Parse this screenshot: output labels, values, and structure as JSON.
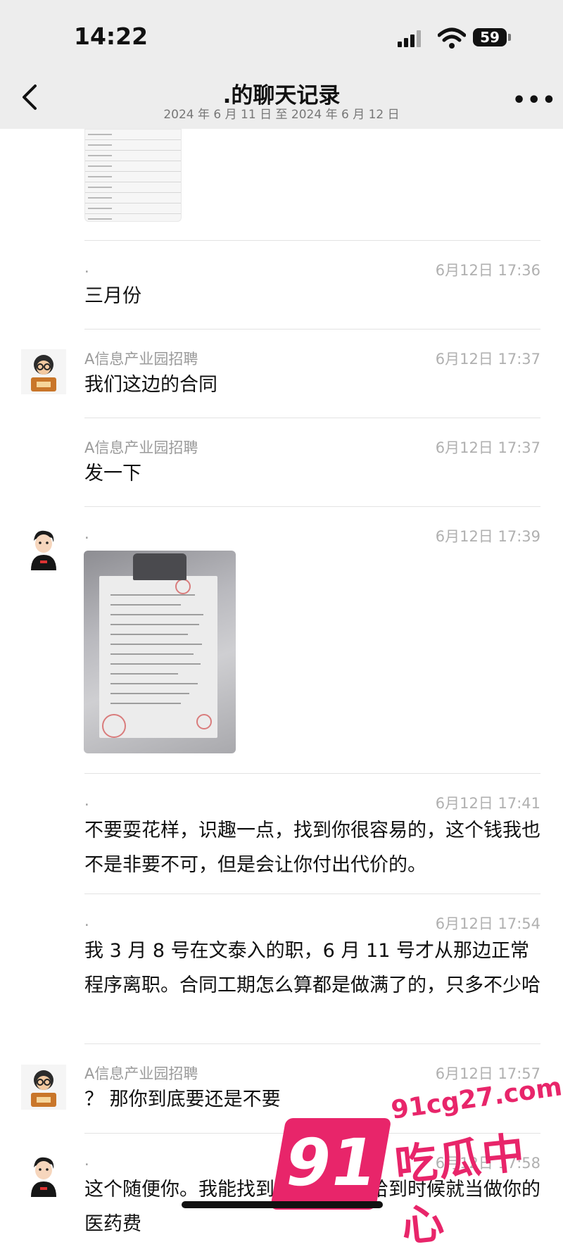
{
  "status": {
    "time": "14:22",
    "battery": "59"
  },
  "nav": {
    "title": ".的聊天记录",
    "subtitle": "2024 年 6 月 11 日 至 2024 年 6 月 12 日"
  },
  "messages": [
    {
      "sender": ".",
      "time": "6月12日 17:36",
      "text": "三月份"
    },
    {
      "sender": "A信息产业园招聘",
      "time": "6月12日 17:37",
      "text": "我们这边的合同"
    },
    {
      "sender": "A信息产业园招聘",
      "time": "6月12日 17:37",
      "text": "发一下"
    },
    {
      "sender": ".",
      "time": "6月12日 17:39",
      "text": ""
    },
    {
      "sender": ".",
      "time": "6月12日 17:41",
      "text": "不要耍花样，识趣一点，找到你很容易的，这个钱我也不是非要不可，但是会让你付出代价的。"
    },
    {
      "sender": ".",
      "time": "6月12日 17:54",
      "text": "我 3 月 8 号在文泰入的职，6 月 11 号才从那边正常程序离职。合同工期怎么算都是做满了的，只多不少哈"
    },
    {
      "sender": "A信息产业园招聘",
      "time": "6月12日 17:57",
      "text": "？ 那你到底要还是不要"
    },
    {
      "sender": ".",
      "time": "6月12日 17:58",
      "text": "这个随便你。我能找到你的。你不给到时候就当做你的医药费"
    }
  ],
  "watermark": {
    "number": "91",
    "site": "91cg27.com",
    "name": "吃瓜中心"
  }
}
